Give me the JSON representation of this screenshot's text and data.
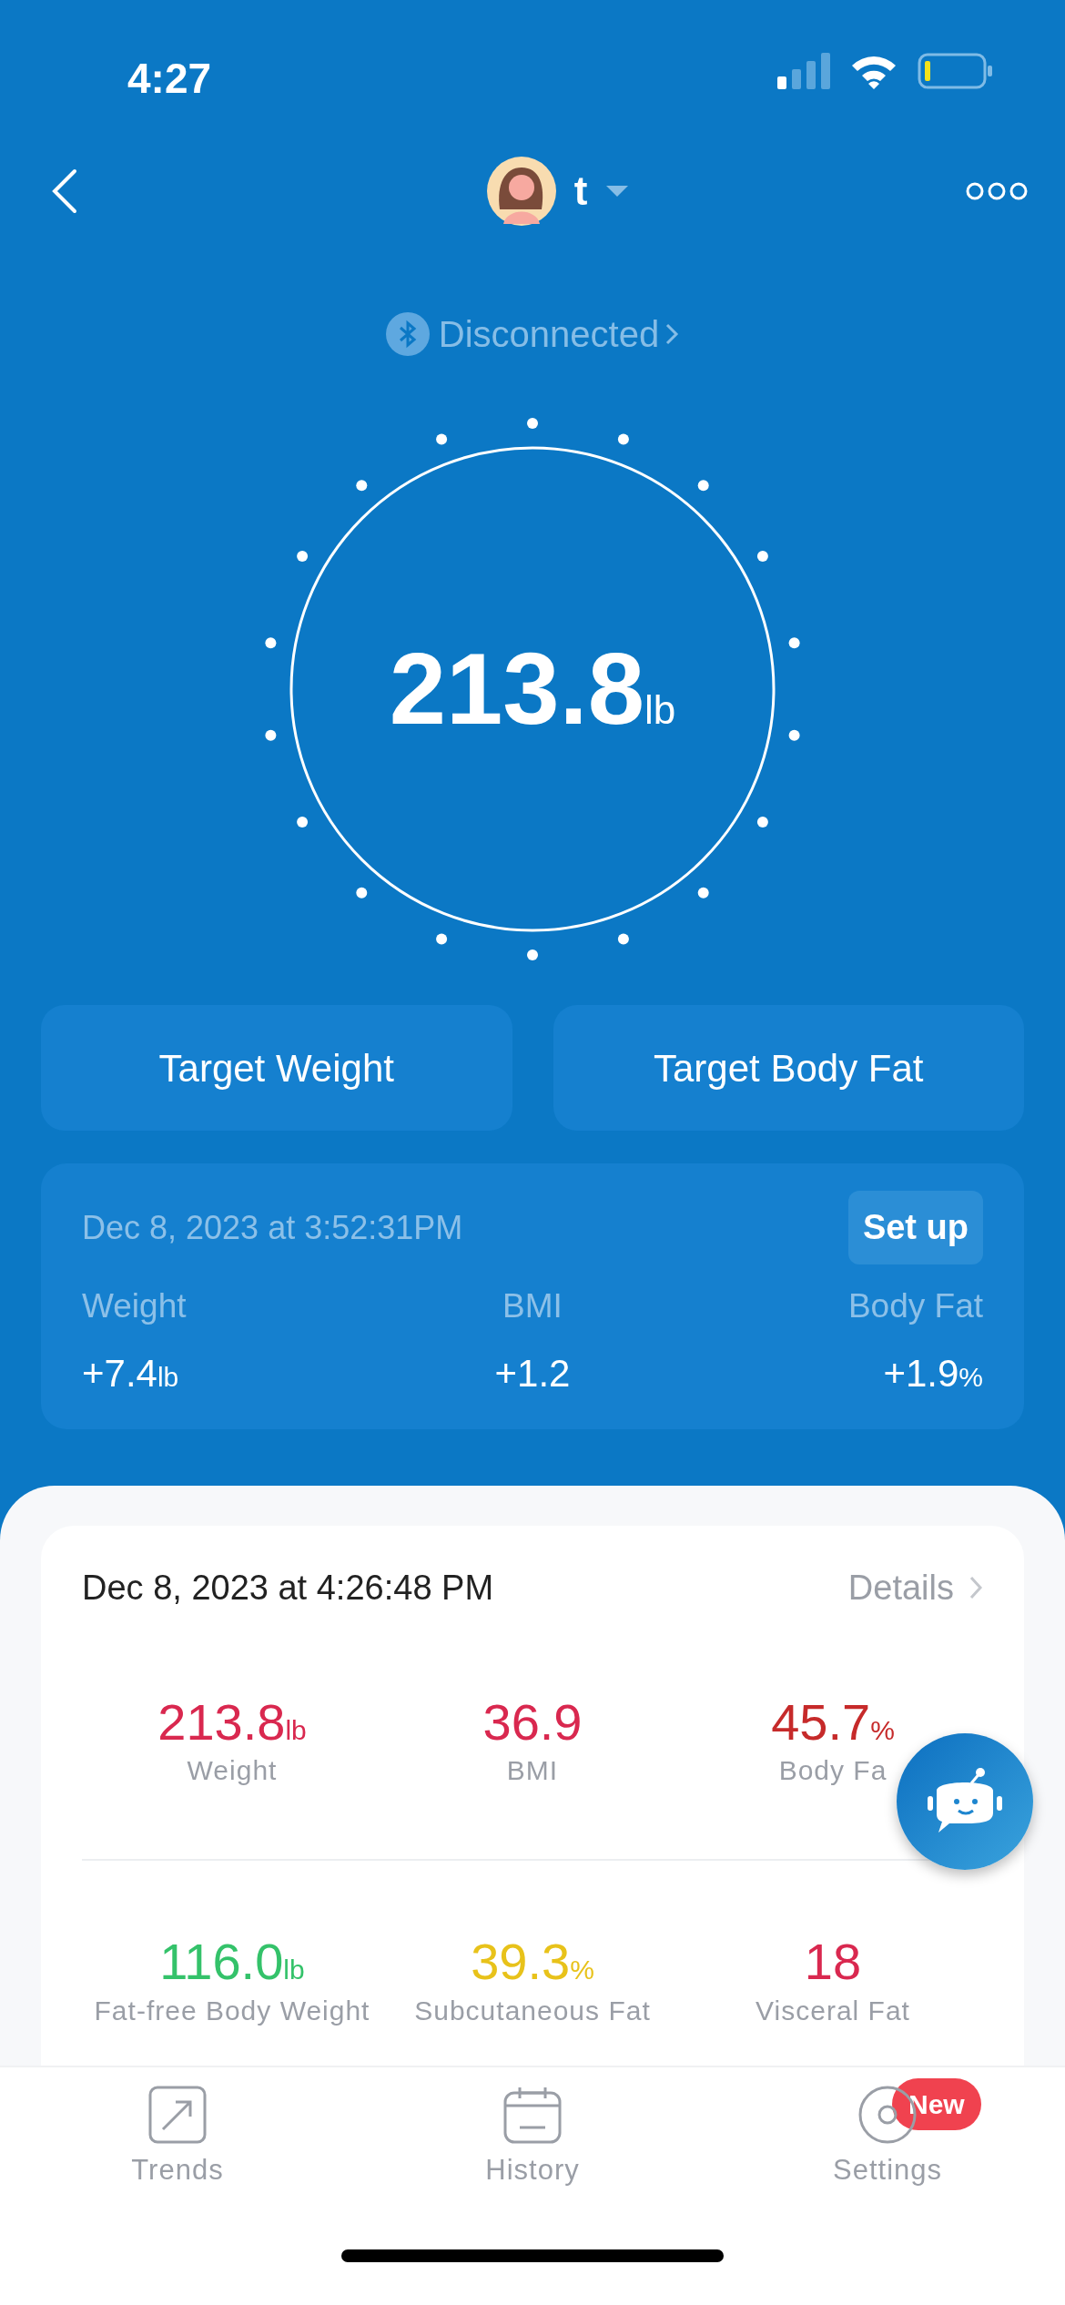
{
  "status_bar": {
    "time": "4:27"
  },
  "header": {
    "user_name": "t"
  },
  "connection": {
    "status": "Disconnected"
  },
  "reading": {
    "value": "213.8",
    "unit": "lb"
  },
  "goal_buttons": [
    {
      "label": "Target Weight"
    },
    {
      "label": "Target Body Fat"
    }
  ],
  "comparison": {
    "timestamp": "Dec 8, 2023 at 3:52:31PM",
    "setup_button": "Set up",
    "items": [
      {
        "label": "Weight",
        "value": "+7.4",
        "unit": "lb"
      },
      {
        "label": "BMI",
        "value": "+1.2"
      },
      {
        "label": "Body Fat",
        "value": "+1.9",
        "unit": "%"
      }
    ]
  },
  "latest": {
    "timestamp": "Dec 8, 2023 at 4:26:48 PM",
    "details_link": "Details",
    "metrics": [
      {
        "value": "213.8",
        "unit": "lb",
        "label": "Weight",
        "color": "#d9284f"
      },
      {
        "value": "36.9",
        "label": "BMI",
        "color": "#d9284f"
      },
      {
        "value": "45.7",
        "unit": "%",
        "label": "Body Fa",
        "color": "#c62a2a"
      },
      {
        "value": "116.0",
        "unit": "lb",
        "label": "Fat-free Body Weight",
        "color": "#34c26a"
      },
      {
        "value": "39.3",
        "unit": "%",
        "label": "Subcutaneous Fat",
        "color": "#e8c21a"
      },
      {
        "value": "18",
        "label": "Visceral Fat",
        "color": "#d9284f"
      }
    ]
  },
  "tab_bar": [
    {
      "kind": "trends",
      "label": "Trends"
    },
    {
      "kind": "history",
      "label": "History"
    },
    {
      "kind": "settings",
      "label": "Settings",
      "badge": "New"
    }
  ]
}
